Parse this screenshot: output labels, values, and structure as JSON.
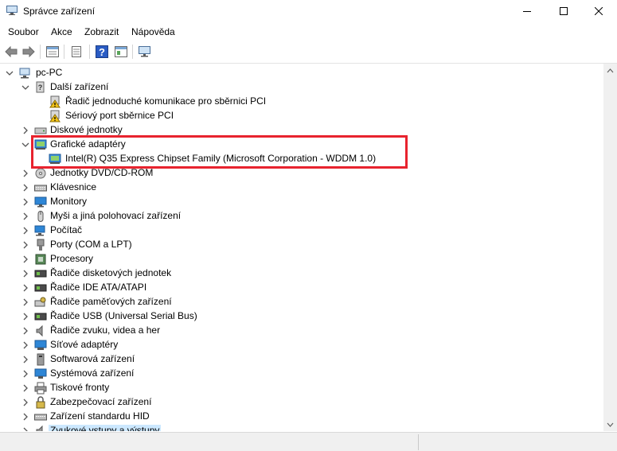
{
  "window": {
    "title": "Správce zařízení"
  },
  "menu": [
    "Soubor",
    "Akce",
    "Zobrazit",
    "Nápověda"
  ],
  "toolbar": {
    "buttons": [
      "back-icon",
      "forward-icon",
      "properties-icon",
      "driver-details-icon",
      "help-icon",
      "action-view-icon",
      "monitor-scan-icon"
    ]
  },
  "tree": {
    "root": "pc-PC",
    "items": [
      {
        "label": "Další zařízení",
        "expanded": true,
        "icon": "unknown-device-icon"
      },
      {
        "label": "Řadič jednoduché komunikace pro sběrnici PCI",
        "child": true,
        "icon": "warning-device-icon"
      },
      {
        "label": "Sériový port sběrnice PCI",
        "child": true,
        "icon": "warning-device-icon"
      },
      {
        "label": "Diskové jednotky",
        "icon": "disk-icon"
      },
      {
        "label": "Grafické adaptéry",
        "expanded": true,
        "icon": "display-adapter-icon"
      },
      {
        "label": "Intel(R) Q35 Express Chipset Family (Microsoft Corporation - WDDM 1.0)",
        "child": true,
        "icon": "display-adapter-icon"
      },
      {
        "label": "Jednotky DVD/CD-ROM",
        "icon": "dvd-icon"
      },
      {
        "label": "Klávesnice",
        "icon": "keyboard-icon"
      },
      {
        "label": "Monitory",
        "icon": "monitor-icon"
      },
      {
        "label": "Myši a jiná polohovací zařízení",
        "icon": "mouse-icon"
      },
      {
        "label": "Počítač",
        "icon": "computer-icon"
      },
      {
        "label": "Porty (COM a LPT)",
        "icon": "port-icon"
      },
      {
        "label": "Procesory",
        "icon": "cpu-icon"
      },
      {
        "label": "Řadiče disketových jednotek",
        "icon": "floppy-controller-icon"
      },
      {
        "label": "Řadiče IDE ATA/ATAPI",
        "icon": "ide-controller-icon"
      },
      {
        "label": "Řadiče paměťových zařízení",
        "icon": "storage-controller-icon"
      },
      {
        "label": "Řadiče USB (Universal Serial Bus)",
        "icon": "usb-icon"
      },
      {
        "label": "Řadiče zvuku, videa a her",
        "icon": "speaker-icon"
      },
      {
        "label": "Síťové adaptéry",
        "icon": "network-icon"
      },
      {
        "label": "Softwarová zařízení",
        "icon": "software-device-icon"
      },
      {
        "label": "Systémová zařízení",
        "icon": "system-device-icon"
      },
      {
        "label": "Tiskové fronty",
        "icon": "printer-icon"
      },
      {
        "label": "Zabezpečovací zařízení",
        "icon": "security-device-icon"
      },
      {
        "label": "Zařízení standardu HID",
        "icon": "hid-icon"
      },
      {
        "label": "Zvukové vstupy a výstupy",
        "icon": "audio-io-icon",
        "selected": true
      }
    ]
  },
  "colors": {
    "highlight": "#e8232e",
    "selection": "#cce8ff"
  }
}
